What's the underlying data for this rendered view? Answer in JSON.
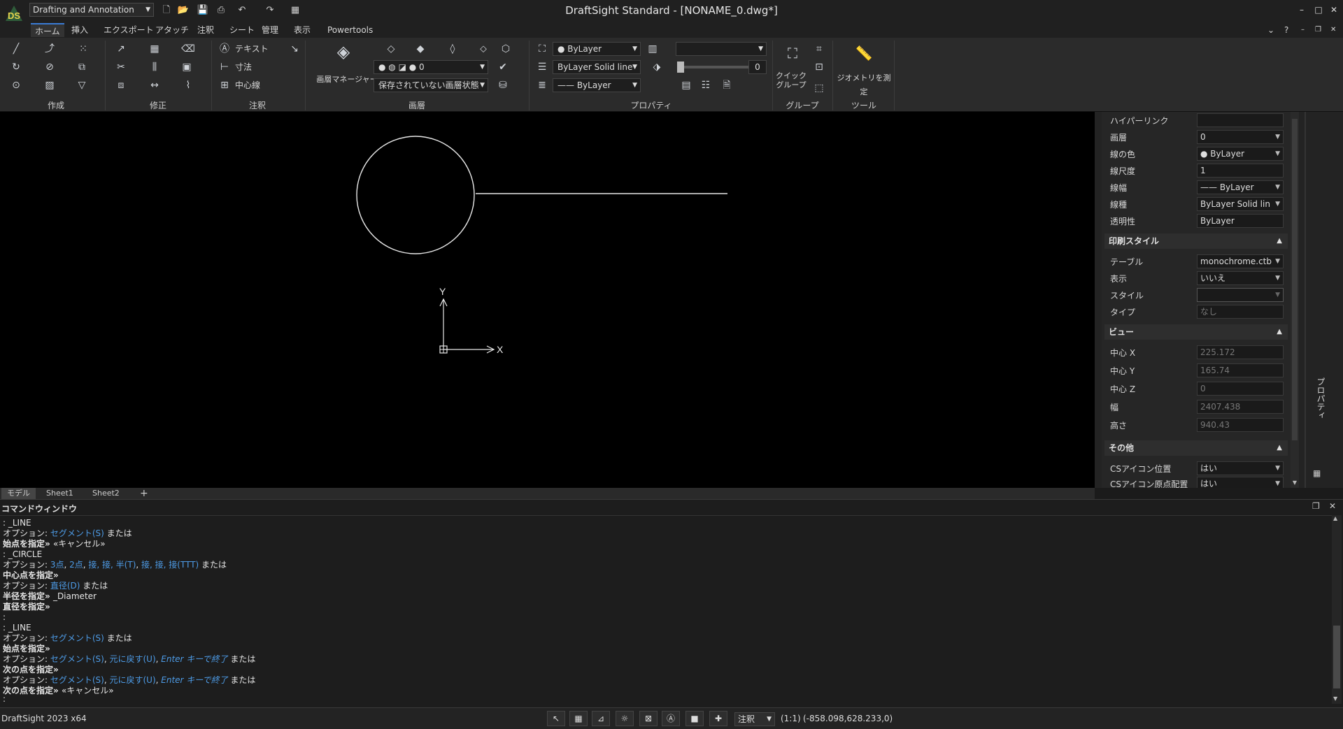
{
  "titlebar": {
    "workspace": "Drafting and Annotation",
    "title": "DraftSight Standard - [NONAME_0.dwg*]",
    "quick_icons": [
      "new-icon",
      "open-icon",
      "save-icon",
      "print-icon",
      "undo-icon",
      "redo-icon",
      "grid-menu-icon"
    ],
    "win_min": "–",
    "win_max": "□",
    "win_close": "✕"
  },
  "menu": {
    "tabs": [
      "ホーム",
      "挿入",
      "エクスポート",
      "アタッチ",
      "注釈",
      "シート",
      "管理",
      "表示",
      "Powertools"
    ],
    "active": "ホーム",
    "help": "?"
  },
  "ribbon": {
    "groups": {
      "create": "作成",
      "modify": "修正",
      "annotate": "注釈",
      "layer": "画層",
      "properties": "プロパティ",
      "group": "グループ",
      "tools": "ツール"
    },
    "annotate": {
      "text": "テキスト",
      "dimension": "寸法",
      "centerline": "中心線"
    },
    "layer": {
      "manager": "画層マネージャー",
      "current": "0",
      "state": "保存されていない画層状態"
    },
    "properties": {
      "color": "ByLayer",
      "linetype_scale_label": "ByLayer",
      "linetype": "Solid line",
      "lineweight": "ByLayer",
      "transparency": "0"
    },
    "group": {
      "quick_group": "クイック グループ"
    },
    "tools": {
      "measure": "ジオメトリを測定"
    }
  },
  "properties_panel": {
    "tab_label": "プロパティ",
    "general": [
      {
        "label": "ハイパーリンク",
        "value": "",
        "dropdown": false
      },
      {
        "label": "画層",
        "value": "0",
        "dropdown": true
      },
      {
        "label": "線の色",
        "value": "● ByLayer",
        "dropdown": true
      },
      {
        "label": "線尺度",
        "value": "1",
        "dropdown": false
      },
      {
        "label": "線幅",
        "value": "—— ByLayer",
        "dropdown": true
      },
      {
        "label": "線種",
        "value": "ByLayer    Solid lin",
        "dropdown": true
      },
      {
        "label": "透明性",
        "value": "ByLayer",
        "dropdown": false
      }
    ],
    "print_style": {
      "title": "印刷スタイル",
      "rows": [
        {
          "label": "テーブル",
          "value": "monochrome.ctb",
          "dropdown": true
        },
        {
          "label": "表示",
          "value": "いいえ",
          "dropdown": true
        },
        {
          "label": "スタイル",
          "value": "",
          "dropdown": true
        },
        {
          "label": "タイプ",
          "value": "なし",
          "dropdown": false
        }
      ]
    },
    "view": {
      "title": "ビュー",
      "rows": [
        {
          "label": "中心 X",
          "value": "225.172"
        },
        {
          "label": "中心 Y",
          "value": "165.74"
        },
        {
          "label": "中心 Z",
          "value": "0"
        },
        {
          "label": "幅",
          "value": "2407.438"
        },
        {
          "label": "高さ",
          "value": "940.43"
        }
      ]
    },
    "other": {
      "title": "その他",
      "rows": [
        {
          "label": "CSアイコン位置",
          "value": "はい",
          "dropdown": true
        },
        {
          "label": "CSアイコン原点配置",
          "value": "はい",
          "dropdown": true
        }
      ]
    }
  },
  "canvas": {
    "axis_x": "X",
    "axis_y": "Y"
  },
  "sheet_tabs": [
    "モデル",
    "Sheet1",
    "Sheet2"
  ],
  "active_sheet": "モデル",
  "add_sheet": "+",
  "command_window": {
    "title": "コマンドウィンドウ",
    "lines": [
      [
        {
          "t": ": _LINE",
          "s": "n"
        }
      ],
      [
        {
          "t": "オプション: ",
          "s": "n"
        },
        {
          "t": "セグメント(S)",
          "s": "l"
        },
        {
          "t": " または",
          "s": "n"
        }
      ],
      [
        {
          "t": "始点を指定» ",
          "s": "b"
        },
        {
          "t": "«キャンセル»",
          "s": "n"
        }
      ],
      [
        {
          "t": ": _CIRCLE",
          "s": "n"
        }
      ],
      [
        {
          "t": "オプション: ",
          "s": "n"
        },
        {
          "t": "3点",
          "s": "l"
        },
        {
          "t": ", ",
          "s": "n"
        },
        {
          "t": "2点",
          "s": "l"
        },
        {
          "t": ", ",
          "s": "n"
        },
        {
          "t": "接, 接, 半(T)",
          "s": "l"
        },
        {
          "t": ", ",
          "s": "n"
        },
        {
          "t": "接, 接, 接(TTT)",
          "s": "l"
        },
        {
          "t": " または",
          "s": "n"
        }
      ],
      [
        {
          "t": "中心点を指定»",
          "s": "b"
        }
      ],
      [
        {
          "t": "オプション: ",
          "s": "n"
        },
        {
          "t": "直径(D)",
          "s": "l"
        },
        {
          "t": " または",
          "s": "n"
        }
      ],
      [
        {
          "t": "半径を指定» ",
          "s": "b"
        },
        {
          "t": "_Diameter",
          "s": "n"
        }
      ],
      [
        {
          "t": "直径を指定»",
          "s": "b"
        }
      ],
      [
        {
          "t": ":",
          "s": "n"
        }
      ],
      [
        {
          "t": ": _LINE",
          "s": "n"
        }
      ],
      [
        {
          "t": "オプション: ",
          "s": "n"
        },
        {
          "t": "セグメント(S)",
          "s": "l"
        },
        {
          "t": " または",
          "s": "n"
        }
      ],
      [
        {
          "t": "始点を指定»",
          "s": "b"
        }
      ],
      [
        {
          "t": "オプション: ",
          "s": "n"
        },
        {
          "t": "セグメント(S)",
          "s": "l"
        },
        {
          "t": ", ",
          "s": "n"
        },
        {
          "t": "元に戻す(U)",
          "s": "l"
        },
        {
          "t": ", ",
          "s": "n"
        },
        {
          "t": "Enter キーで終了",
          "s": "i"
        },
        {
          "t": " または",
          "s": "n"
        }
      ],
      [
        {
          "t": "次の点を指定»",
          "s": "b"
        }
      ],
      [
        {
          "t": "オプション: ",
          "s": "n"
        },
        {
          "t": "セグメント(S)",
          "s": "l"
        },
        {
          "t": ", ",
          "s": "n"
        },
        {
          "t": "元に戻す(U)",
          "s": "l"
        },
        {
          "t": ", ",
          "s": "n"
        },
        {
          "t": "Enter キーで終了",
          "s": "i"
        },
        {
          "t": " または",
          "s": "n"
        }
      ],
      [
        {
          "t": "次の点を指定» ",
          "s": "b"
        },
        {
          "t": "«キャンセル»",
          "s": "n"
        }
      ]
    ],
    "prompt": ":"
  },
  "statusbar": {
    "version": "DraftSight 2023 x64",
    "annotation": "注釈",
    "scale": "(1:1)",
    "coords": "(-858.098,628.233,0)"
  }
}
